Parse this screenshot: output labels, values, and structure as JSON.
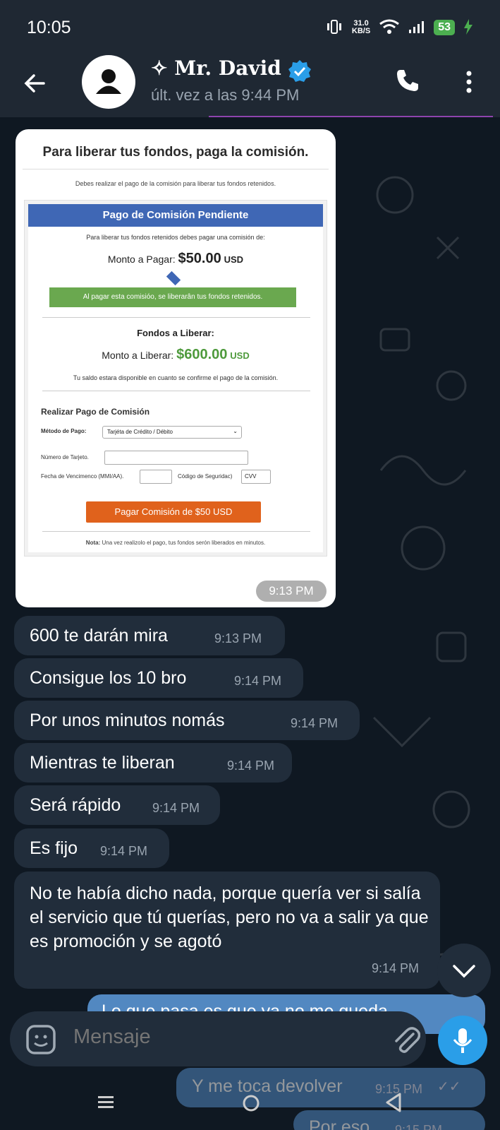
{
  "status_bar": {
    "time": "10:05",
    "net_speed_value": "31.0",
    "net_speed_unit": "KB/S",
    "battery": "53"
  },
  "header": {
    "name": "✧ Mr. David",
    "last_seen": "últ. vez a las 9:44 PM"
  },
  "image_message": {
    "doc_title": "Para liberar tus fondos, paga la comisión.",
    "doc_subtitle": "Debes realizar el pago de la comisión para liberar tus fondos retenidos.",
    "card_title": "Pago de Comisión Pendiente",
    "commission_text": "Para liberar tus fondos retenidos debes pagar una comisión de:",
    "pay_label": "Monto a Pagar:",
    "pay_amount": "$50.00",
    "currency": "USD",
    "green_notice": "Al pagar esta comisióo, se liberarân tus fondos retenidos.",
    "release_title": "Fondos a Liberar:",
    "release_label": "Monto a Liberar:",
    "release_amount": "$600.00",
    "balance_note": "Tu saldo estara disponible en cuanto se confirme el pago de la comisión.",
    "form_title": "Realizar Pago de Comisión",
    "method_label": "Método de Pago:",
    "method_value": "Tarjéta de Crédito / Débito",
    "card_number_label": "Número de Tarjeto.",
    "expiry_label": "Fecha de Vencimenco (MMI/AA).",
    "cvv_label": "Código de Seguridac)",
    "cvv_placeholder": "CVV",
    "pay_button": "Pagar Comisión de $50 USD",
    "note_bold": "Nota:",
    "note_text": "Una vez realizolo el pago, tus fondos serón liberados en minutos.",
    "time": "9:13 PM"
  },
  "messages": [
    {
      "text": "600 te darán mira",
      "time": "9:13 PM"
    },
    {
      "text": "Consigue los 10 bro",
      "time": "9:14 PM"
    },
    {
      "text": "Por unos minutos nomás",
      "time": "9:14 PM"
    },
    {
      "text": "Mientras te liberan",
      "time": "9:14 PM"
    },
    {
      "text": "Será rápido",
      "time": "9:14 PM"
    },
    {
      "text": "Es fijo",
      "time": "9:14 PM"
    },
    {
      "text": "No te había dicho nada, porque quería ver si salía el servicio que tú querías, pero no va a salir ya que es promoción y se agotó",
      "time": "9:14 PM"
    }
  ],
  "outgoing": [
    {
      "text": "Lo que pasa es que ya no me queda",
      "time": ""
    },
    {
      "text": "Y me toca devolver",
      "time": "9:15 PM"
    },
    {
      "text": "Por eso",
      "time": "9:15 PM"
    }
  ],
  "composer": {
    "placeholder": "Mensaje"
  },
  "colors": {
    "background": "#0f1822",
    "bubble_in": "#212d3b",
    "bubble_out": "#5288c1",
    "accent": "#2a9ee8"
  }
}
